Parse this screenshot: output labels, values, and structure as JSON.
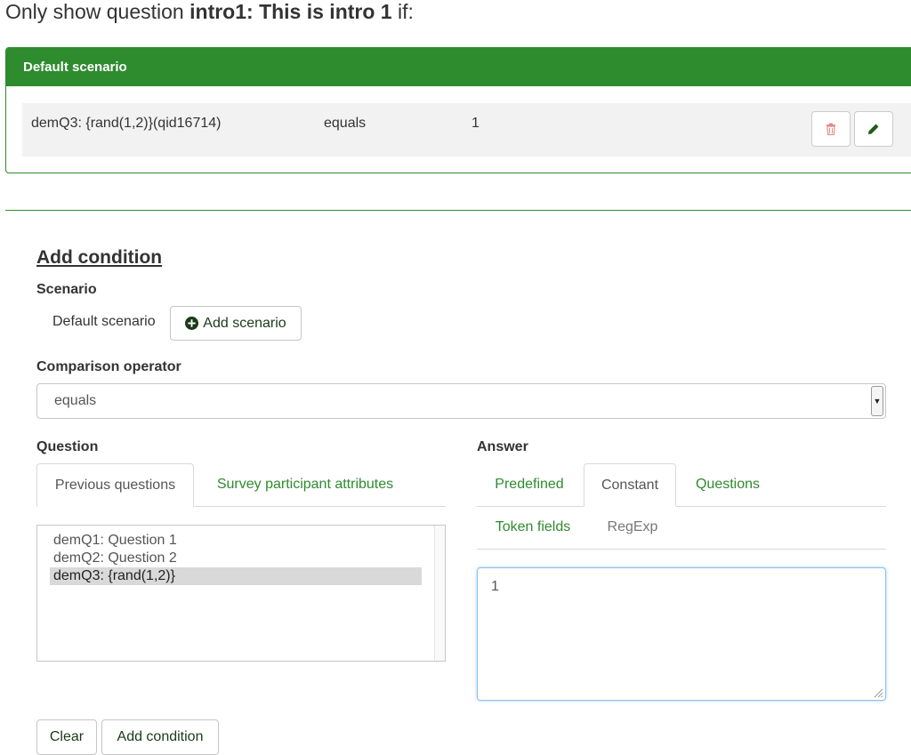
{
  "heading": {
    "prefix": "Only show question",
    "question": "intro1: This is intro 1",
    "suffix": "if:"
  },
  "scenario_panel": {
    "title": "Default scenario",
    "condition": {
      "question": "demQ3: {rand(1,2)}(qid16714)",
      "operator": "equals",
      "value": "1"
    },
    "delete_icon": "trash-icon",
    "edit_icon": "pencil-icon",
    "colors": {
      "header": "#2e8b2e",
      "delete": "#e88a8a",
      "edit": "#1f5c1f"
    }
  },
  "form": {
    "title": "Add condition",
    "scenario_label": "Scenario",
    "scenario_value": "Default scenario",
    "add_scenario_label": "Add scenario",
    "add_scenario_icon": "plus-circle-icon",
    "operator_label": "Comparison operator",
    "operator_value": "equals",
    "question_label": "Question",
    "question_tabs": [
      {
        "label": "Previous questions",
        "active": true
      },
      {
        "label": "Survey participant attributes",
        "active": false
      }
    ],
    "questions": [
      {
        "label": "demQ1: Question 1",
        "selected": false
      },
      {
        "label": "demQ2: Question 2",
        "selected": false
      },
      {
        "label": "demQ3: {rand(1,2)}",
        "selected": true
      }
    ],
    "answer_label": "Answer",
    "answer_tabs": [
      {
        "label": "Predefined",
        "state": "link"
      },
      {
        "label": "Constant",
        "state": "active"
      },
      {
        "label": "Questions",
        "state": "link"
      },
      {
        "label": "Token fields",
        "state": "link"
      },
      {
        "label": "RegExp",
        "state": "muted"
      }
    ],
    "answer_value": "1",
    "clear_label": "Clear",
    "submit_label": "Add condition"
  }
}
